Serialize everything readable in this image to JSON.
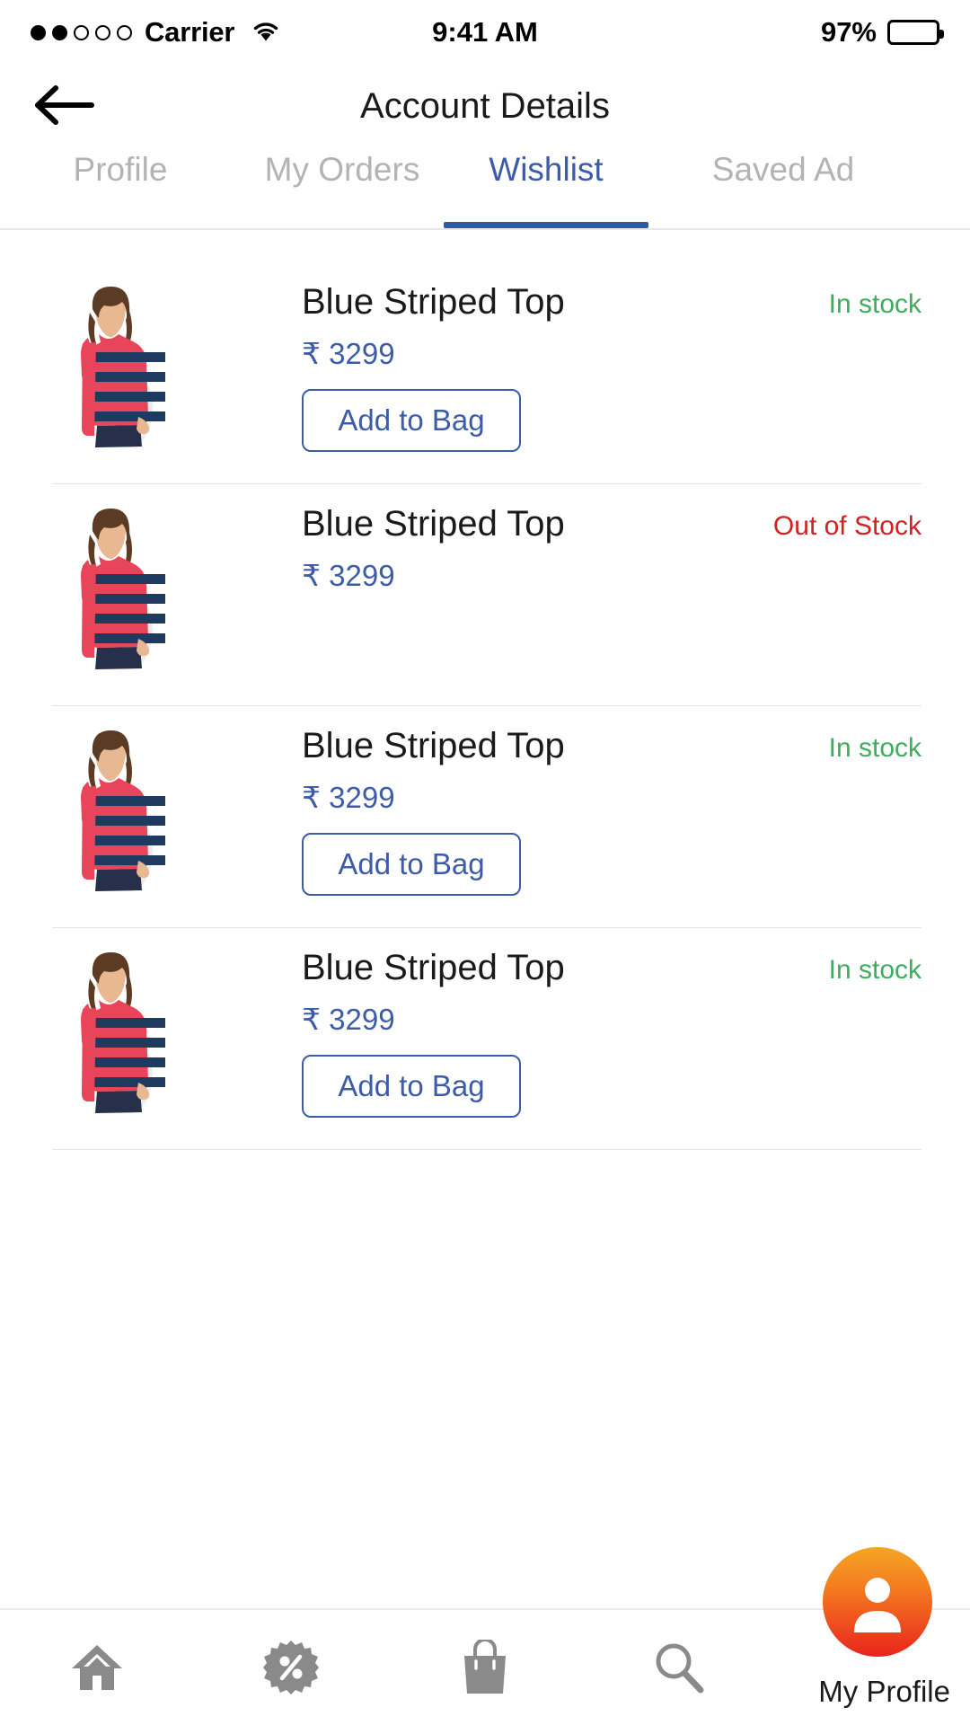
{
  "status_bar": {
    "carrier": "Carrier",
    "signal_bars_filled": 2,
    "signal_bars_total": 5,
    "wifi_icon": "wifi-icon",
    "time": "9:41 AM",
    "battery_percent": "97%",
    "battery_level": 0.97
  },
  "header": {
    "back_icon": "arrow-left-icon",
    "title": "Account Details"
  },
  "tabs": {
    "active_index": 2,
    "accent_color": "#2f5aa8",
    "inactive_color": "#b3b3b3",
    "items": [
      {
        "label": "Profile"
      },
      {
        "label": "My Orders"
      },
      {
        "label": "Wishlist"
      },
      {
        "label": "Saved Ad"
      }
    ]
  },
  "wishlist": {
    "currency_symbol": "₹",
    "colors": {
      "price": "#3c5ca8",
      "in_stock": "#3cae5c",
      "out_of_stock": "#d32020",
      "button_border": "#3c5ca8"
    },
    "items": [
      {
        "name": "Blue Striped Top",
        "price": "₹ 3299",
        "stock_status": "In stock",
        "in_stock": true,
        "action_label": "Add to Bag",
        "show_action": true
      },
      {
        "name": "Blue Striped Top",
        "price": "₹ 3299",
        "stock_status": "Out of Stock",
        "in_stock": false,
        "action_label": "Add to Bag",
        "show_action": false
      },
      {
        "name": "Blue Striped Top",
        "price": "₹ 3299",
        "stock_status": "In stock",
        "in_stock": true,
        "action_label": "Add to Bag",
        "show_action": true
      },
      {
        "name": "Blue Striped Top",
        "price": "₹ 3299",
        "stock_status": "In stock",
        "in_stock": true,
        "action_label": "Add to Bag",
        "show_action": true
      }
    ]
  },
  "bottom_nav": {
    "items": [
      {
        "icon": "home-icon"
      },
      {
        "icon": "offers-percent-badge-icon"
      },
      {
        "icon": "shopping-bag-icon"
      },
      {
        "icon": "search-icon"
      }
    ],
    "profile": {
      "icon": "person-avatar-icon",
      "label": "My Profile",
      "gradient_from": "#f5a623",
      "gradient_to": "#e8241c"
    }
  }
}
